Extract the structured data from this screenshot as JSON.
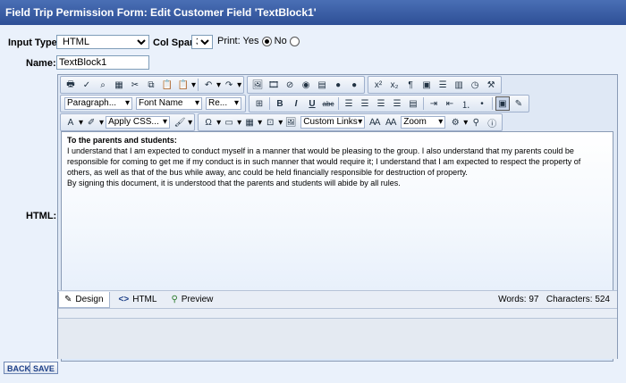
{
  "window": {
    "title": "Field Trip Permission Form: Edit Customer Field 'TextBlock1'"
  },
  "form": {
    "input_type_label": "Input Type:",
    "input_type_value": "HTML",
    "col_span_label": "Col Span:",
    "col_span_value": "3",
    "print_label": "Print:",
    "print_yes": "Yes",
    "print_no": "No",
    "print_selected": "Yes",
    "name_label": "Name:",
    "name_value": "TextBlock1",
    "html_label": "HTML:"
  },
  "toolbar": {
    "row1_icons": [
      "print-icon",
      "spellcheck-icon",
      "find-icon",
      "select-all-icon",
      "cut-icon",
      "copy-icon",
      "paste-icon",
      "paste-special-icon",
      "undo-icon",
      "redo-icon",
      "image-manager-icon",
      "media-icon",
      "flash-icon",
      "link-icon",
      "document-icon",
      "hyperlink-icon",
      "unlink-icon",
      "superscript-icon",
      "subscript-icon",
      "paragraph-icon",
      "template-icon",
      "horizontal-rule-icon",
      "page-properties-icon",
      "date-icon",
      "clean-icon"
    ],
    "paragraph_combo": "Paragraph...",
    "font_name_combo": "Font Name",
    "size_combo": "Re...",
    "bold": "B",
    "italic": "I",
    "underline": "U",
    "strike": "abc",
    "apply_css_combo": "Apply CSS...",
    "custom_links_combo": "Custom Links",
    "zoom_combo": "Zoom"
  },
  "editor": {
    "heading": "To the parents and students:",
    "paragraph1": "I understand that I am expected to conduct myself in a manner that would be pleasing to the group.  I also understand that my parents could be responsible for coming to get me if my conduct is in such manner that would require it; I understand that I am expected to respect the property of others, as well as that of the bus while away, anc could be held financially responsible for destruction of property.",
    "paragraph2": "By signing this document, it is understood that the parents and students will abide by all rules.",
    "mode_design": "Design",
    "mode_html": "HTML",
    "mode_preview": "Preview",
    "words_label": "Words:",
    "words_value": "97",
    "chars_label": "Characters:",
    "chars_value": "524"
  },
  "buttons": {
    "back": "BACK",
    "save": "SAVE"
  },
  "colors": {
    "title_bg": "#3a5ca6",
    "page_bg": "#eaf1fb",
    "accent": "#1d3f87"
  }
}
